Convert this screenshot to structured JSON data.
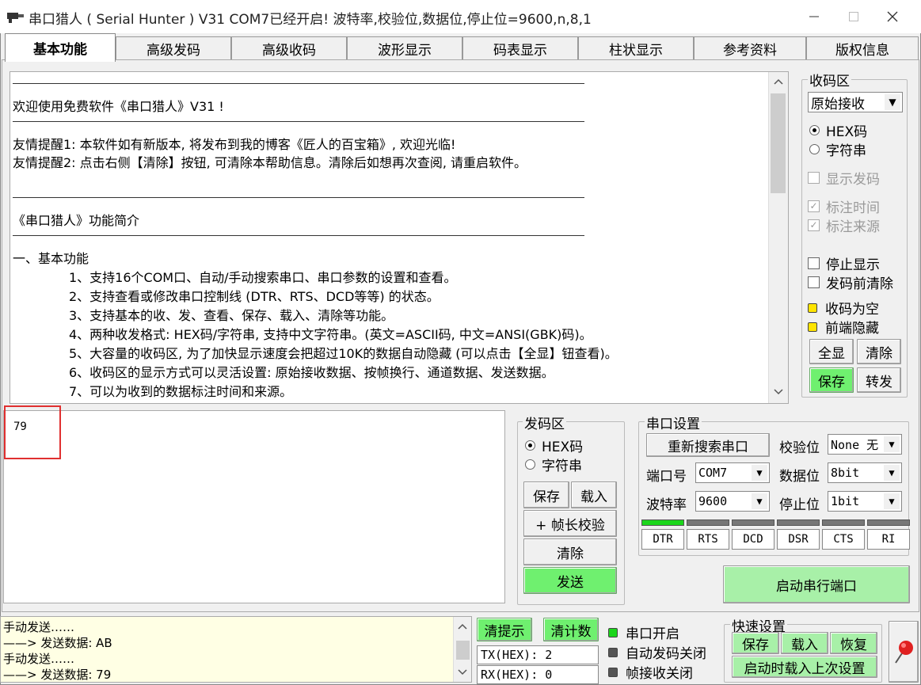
{
  "window": {
    "title": "串口猎人 ( Serial Hunter ) V31    COM7已经开启!  波特率,校验位,数据位,停止位=9600,n,8,1"
  },
  "tabs": [
    "基本功能",
    "高级发码",
    "高级收码",
    "波形显示",
    "码表显示",
    "柱状显示",
    "参考资料",
    "版权信息"
  ],
  "receive_text": {
    "line_welcome": "欢迎使用免费软件《串口猎人》V31 !",
    "line_tip1": "友情提醒1: 本软件如有新版本, 将发布到我的博客《匠人的百宝箱》, 欢迎光临!",
    "line_tip2": "友情提醒2: 点击右侧【清除】按钮, 可清除本帮助信息。清除后如想再次查阅, 请重启软件。",
    "line_intro": "《串口猎人》功能简介",
    "line_basic": "一、基本功能",
    "features": [
      "1、支持16个COM口、自动/手动搜索串口、串口参数的设置和查看。",
      "2、支持查看或修改串口控制线 (DTR、RTS、DCD等等) 的状态。",
      "3、支持基本的收、发、查看、保存、载入、清除等功能。",
      "4、两种收发格式: HEX码/字符串, 支持中文字符串。(英文=ASCII码, 中文=ANSI(GBK)码)。",
      "5、大容量的收码区, 为了加快显示速度会把超过10K的数据自动隐藏 (可以点击【全显】钮查看)。",
      "6、收码区的显示方式可以灵活设置: 原始接收数据、按帧换行、通道数据、发送数据。",
      "7、可以为收到的数据标注时间和来源。"
    ]
  },
  "recv_panel": {
    "title": "收码区",
    "mode_value": "原始接收",
    "radio_hex": "HEX码",
    "radio_str": "字符串",
    "show_send": "显示发码",
    "mark_time": "标注时间",
    "mark_source": "标注来源",
    "stop_display": "停止显示",
    "clear_before_send": "发码前清除",
    "recv_empty": "收码为空",
    "front_hidden": "前端隐藏",
    "btn_full": "全显",
    "btn_clear": "清除",
    "btn_save": "保存",
    "btn_forward": "转发"
  },
  "send_area": {
    "value": "79"
  },
  "send_panel": {
    "title": "发码区",
    "radio_hex": "HEX码",
    "radio_str": "字符串",
    "btn_save": "保存",
    "btn_load": "载入",
    "btn_frame": "+ 帧长校验",
    "btn_clear": "清除",
    "btn_send": "发送"
  },
  "port_panel": {
    "title": "串口设置",
    "btn_search": "重新搜索串口",
    "parity_label": "校验位",
    "parity_value": "None 无",
    "port_label": "端口号",
    "port_value": "COM7",
    "databits_label": "数据位",
    "databits_value": "8bit",
    "baud_label": "波特率",
    "baud_value": "9600",
    "stopbits_label": "停止位",
    "stopbits_value": "1bit",
    "signals": [
      "DTR",
      "RTS",
      "DCD",
      "DSR",
      "CTS",
      "RI"
    ],
    "btn_start": "启动串行端口"
  },
  "status_log": [
    "手动发送……",
    "——> 发送数据: AB",
    "手动发送……",
    "——> 发送数据: 79"
  ],
  "counters": {
    "btn_clear_tip": "清提示",
    "btn_clear_count": "清计数",
    "tx": "TX(HEX): 2",
    "rx": "RX(HEX): 0"
  },
  "status_flags": {
    "port_open": "串口开启",
    "auto_send_off": "自动发码关闭",
    "frame_recv_off": "帧接收关闭"
  },
  "quick_settings": {
    "title": "快速设置",
    "btn_save": "保存",
    "btn_load": "载入",
    "btn_restore": "恢复",
    "btn_load_last": "启动时载入上次设置"
  },
  "colors": {
    "accent_green": "#6ff06f",
    "status_bg": "#ffffe4",
    "highlight_red": "#e03030"
  }
}
